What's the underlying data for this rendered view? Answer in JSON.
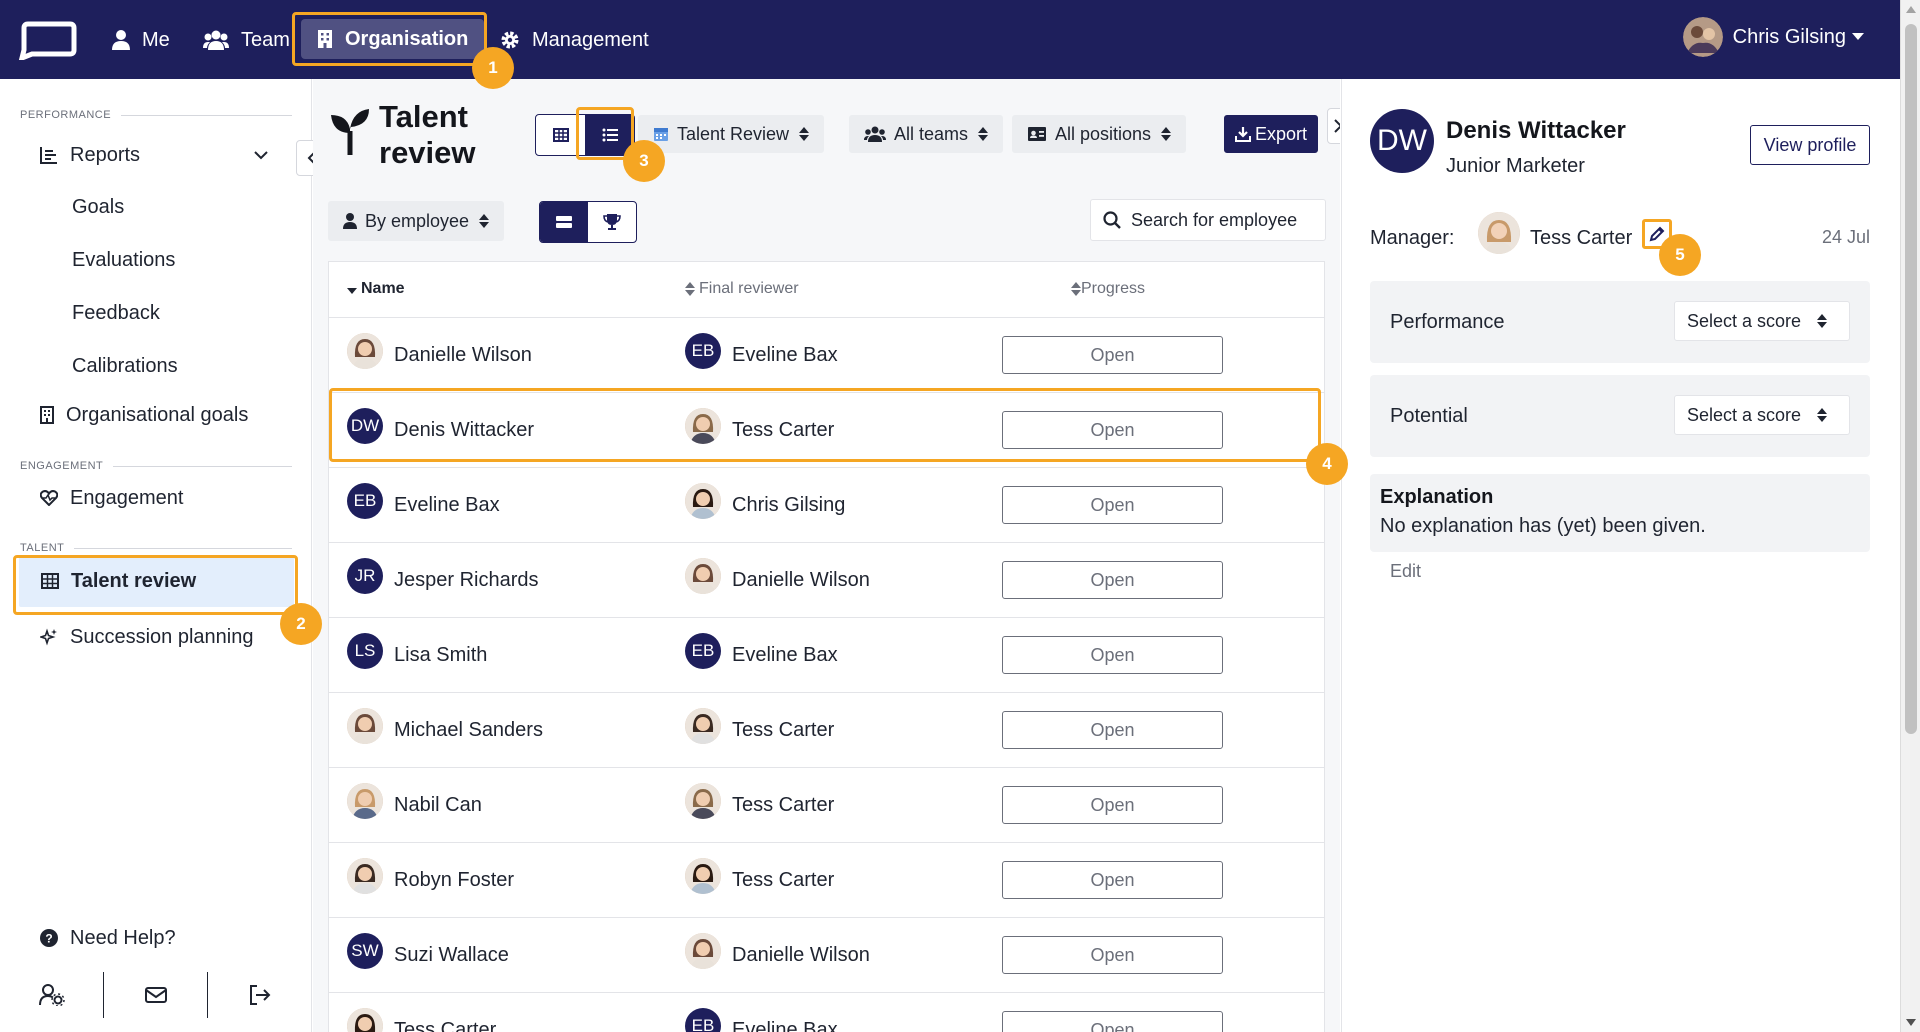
{
  "nav": {
    "items": [
      {
        "label": "Me",
        "icon": "person-icon"
      },
      {
        "label": "Team",
        "icon": "users-icon"
      },
      {
        "label": "Organisation",
        "icon": "building-icon",
        "active": true
      },
      {
        "label": "Management",
        "icon": "gear-icon"
      }
    ],
    "user_name": "Chris Gilsing"
  },
  "sidebar": {
    "sections": {
      "performance": "PERFORMANCE",
      "engagement": "ENGAGEMENT",
      "talent": "TALENT"
    },
    "reports": "Reports",
    "sub_items": [
      "Goals",
      "Evaluations",
      "Feedback",
      "Calibrations"
    ],
    "org_goals": "Organisational goals",
    "engagement": "Engagement",
    "talent_review": "Talent review",
    "succession": "Succession planning",
    "help": "Need Help?"
  },
  "main": {
    "title": "Talent review",
    "cycle_filter": "Talent Review",
    "teams_filter": "All teams",
    "positions_filter": "All positions",
    "export": "Export",
    "group_by": "By employee",
    "search_placeholder": "Search for employee",
    "columns": {
      "name": "Name",
      "reviewer": "Final reviewer",
      "progress": "Progress"
    },
    "open_label": "Open",
    "rows": [
      {
        "name": "Danielle Wilson",
        "initials": "",
        "reviewer": "Eveline Bax",
        "reviewer_initials": "EB"
      },
      {
        "name": "Denis Wittacker",
        "initials": "DW",
        "reviewer": "Tess Carter",
        "reviewer_initials": ""
      },
      {
        "name": "Eveline Bax",
        "initials": "EB",
        "reviewer": "Chris Gilsing",
        "reviewer_initials": ""
      },
      {
        "name": "Jesper Richards",
        "initials": "JR",
        "reviewer": "Danielle Wilson",
        "reviewer_initials": ""
      },
      {
        "name": "Lisa Smith",
        "initials": "LS",
        "reviewer": "Eveline Bax",
        "reviewer_initials": "EB"
      },
      {
        "name": "Michael Sanders",
        "initials": "",
        "reviewer": "Tess Carter",
        "reviewer_initials": ""
      },
      {
        "name": "Nabil Can",
        "initials": "",
        "reviewer": "Tess Carter",
        "reviewer_initials": ""
      },
      {
        "name": "Robyn Foster",
        "initials": "",
        "reviewer": "Tess Carter",
        "reviewer_initials": ""
      },
      {
        "name": "Suzi Wallace",
        "initials": "SW",
        "reviewer": "Danielle Wilson",
        "reviewer_initials": ""
      },
      {
        "name": "Tess Carter",
        "initials": "",
        "reviewer": "Eveline Bax",
        "reviewer_initials": "EB"
      }
    ]
  },
  "panel": {
    "initials": "DW",
    "name": "Denis Wittacker",
    "role": "Junior Marketer",
    "view_profile": "View profile",
    "manager_label": "Manager:",
    "manager_name": "Tess Carter",
    "date": "24 Jul",
    "performance_label": "Performance",
    "potential_label": "Potential",
    "select_score": "Select a score",
    "explanation_title": "Explanation",
    "explanation_text": "No explanation has (yet) been given.",
    "edit": "Edit"
  },
  "annotations": [
    "1",
    "2",
    "3",
    "4",
    "5"
  ],
  "colors": {
    "brand": "#1e1f5c",
    "highlight": "#f5a623",
    "active_bg": "#e3eefc"
  }
}
